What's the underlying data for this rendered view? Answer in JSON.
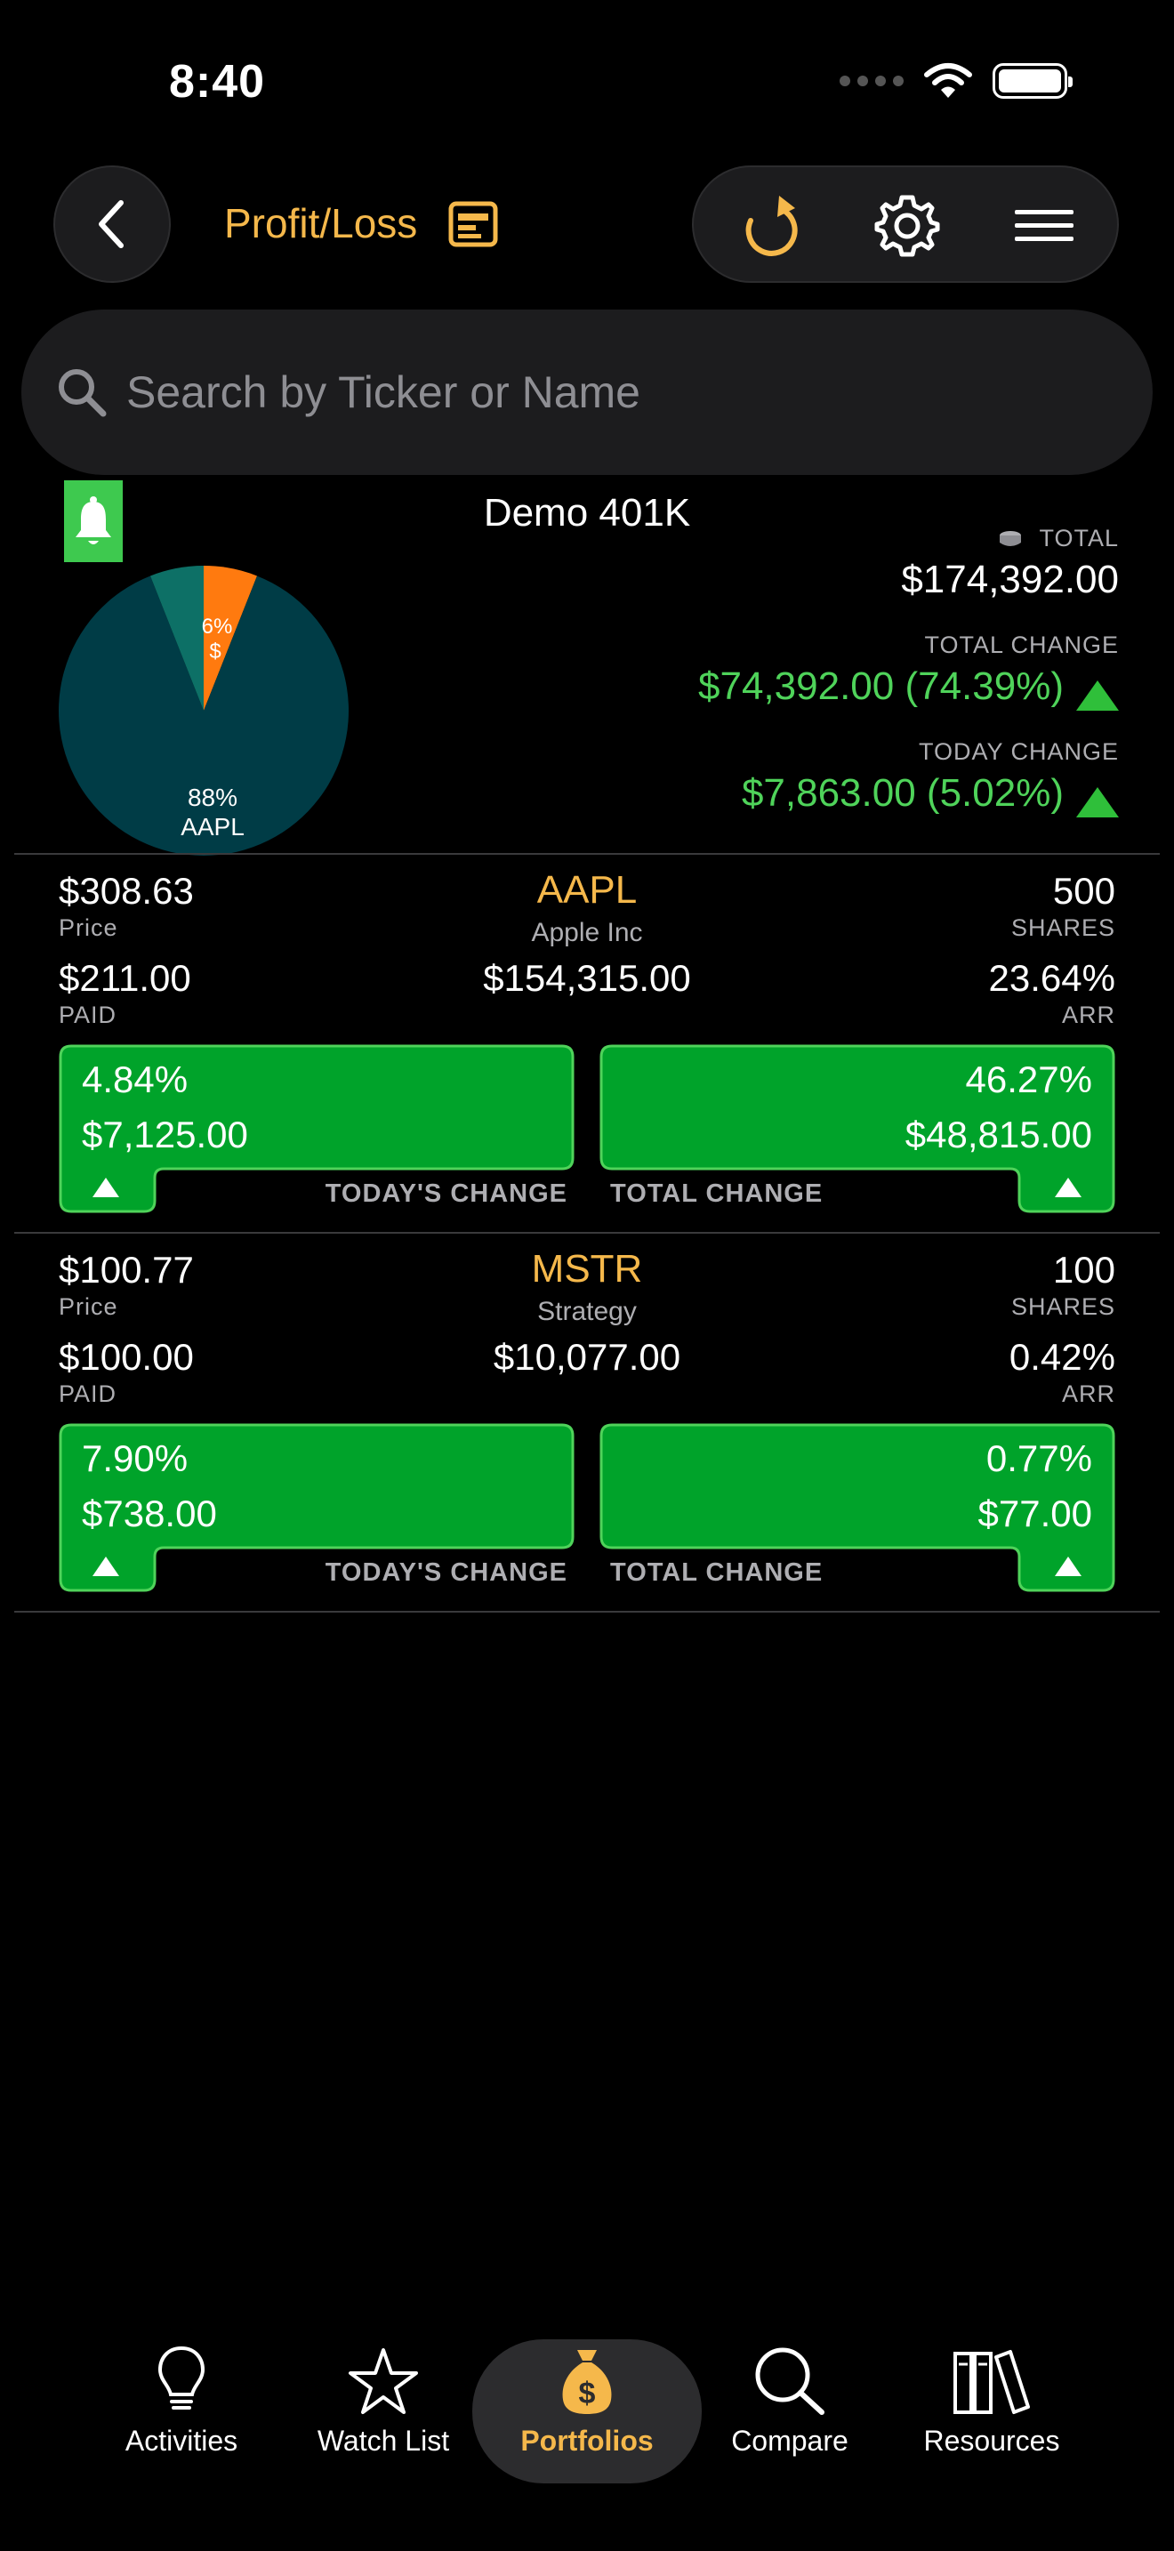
{
  "status": {
    "time": "8:40"
  },
  "nav": {
    "title": "Profit/Loss",
    "icons": [
      "chevron-left-icon",
      "card-icon",
      "refresh-icon",
      "gear-icon",
      "menu-icon"
    ]
  },
  "search": {
    "placeholder": "Search by Ticker or Name",
    "value": ""
  },
  "portfolio": {
    "name": "Demo 401K",
    "total_label": "TOTAL",
    "total_value": "$174,392.00",
    "total_change_label": "TOTAL CHANGE",
    "total_change_value": "$74,392.00 (74.39%)",
    "today_change_label": "TODAY CHANGE",
    "today_change_value": "$7,863.00 (5.02%)",
    "pie": {
      "slices": [
        {
          "label": "AAPL",
          "pct_label": "88%",
          "fraction": 0.88,
          "color": "#003c46"
        },
        {
          "label": "",
          "pct_label": "6%",
          "fraction": 0.06,
          "color": "#0d7066"
        },
        {
          "label": "$",
          "pct_label": "6%",
          "fraction": 0.06,
          "color": "#ff7a0f"
        }
      ]
    }
  },
  "holdings": [
    {
      "price": "$308.63",
      "price_label": "Price",
      "ticker": "AAPL",
      "name": "Apple Inc",
      "shares": "500",
      "shares_label": "SHARES",
      "paid": "$211.00",
      "paid_label": "PAID",
      "value": "$154,315.00",
      "arr": "23.64%",
      "arr_label": "ARR",
      "today_pct": "4.84%",
      "today_amt": "$7,125.00",
      "today_label": "TODAY'S CHANGE",
      "total_pct": "46.27%",
      "total_amt": "$48,815.00",
      "total_label": "TOTAL CHANGE"
    },
    {
      "price": "$100.77",
      "price_label": "Price",
      "ticker": "MSTR",
      "name": "Strategy",
      "shares": "100",
      "shares_label": "SHARES",
      "paid": "$100.00",
      "paid_label": "PAID",
      "value": "$10,077.00",
      "arr": "0.42%",
      "arr_label": "ARR",
      "today_pct": "7.90%",
      "today_amt": "$738.00",
      "today_label": "TODAY'S CHANGE",
      "total_pct": "0.77%",
      "total_amt": "$77.00",
      "total_label": "TOTAL CHANGE"
    }
  ],
  "tabbar": {
    "items": [
      {
        "label": "Activities",
        "icon": "lightbulb-icon"
      },
      {
        "label": "Watch List",
        "icon": "star-icon"
      },
      {
        "label": "Portfolios",
        "icon": "money-bag-icon",
        "active": true
      },
      {
        "label": "Compare",
        "icon": "magnifier-icon"
      },
      {
        "label": "Resources",
        "icon": "books-icon"
      }
    ]
  },
  "colors": {
    "accent": "#f5b84b",
    "positive": "#4fd35a",
    "box_green": "#00a32a",
    "background": "#000000"
  }
}
